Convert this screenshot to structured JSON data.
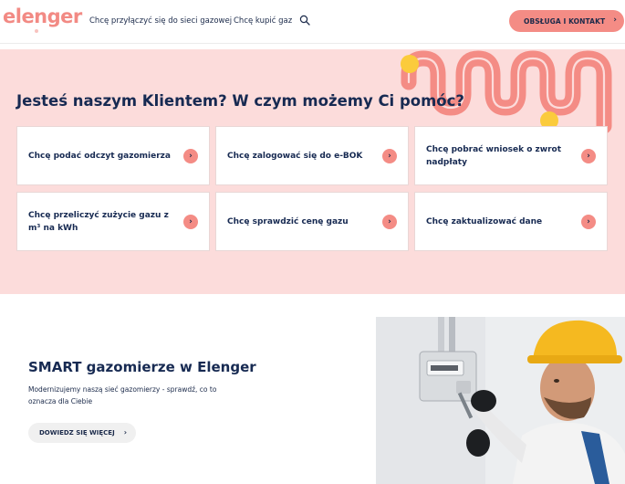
{
  "header": {
    "logo": "elenger",
    "nav": [
      "Chcę przyłączyć się do sieci gazowej",
      "Chcę kupić gaz"
    ],
    "cta_label": "OBSŁUGA I KONTAKT",
    "cta_icon": "chevron-right-icon",
    "search_icon": "search-icon"
  },
  "help": {
    "title": "Jesteś naszym Klientem? W czym możemy Ci pomóc?",
    "cards": [
      {
        "label": "Chcę podać odczyt gazomierza"
      },
      {
        "label": "Chcę zalogować się do e-BOK"
      },
      {
        "label": "Chcę pobrać wniosek o zwrot nadpłaty"
      },
      {
        "label": "Chcę przeliczyć zużycie gazu z m³ na kWh"
      },
      {
        "label": "Chcę sprawdzić cenę gazu"
      },
      {
        "label": "Chcę zaktualizować dane"
      }
    ],
    "card_icon": "arrow-right-icon"
  },
  "smart": {
    "title": "SMART gazomierze w Elenger",
    "description": "Modernizujemy naszą sieć gazomierzy - sprawdź, co to oznacza dla Ciebie",
    "button_label": "DOWIEDZ SIĘ WIĘCEJ",
    "image": "technician-installing-gas-meter-photo"
  },
  "colors": {
    "brand_coral": "#f48c85",
    "pink_background": "#fcdcdb",
    "navy_text": "#172a52",
    "accent_yellow": "#fbcb3c"
  }
}
